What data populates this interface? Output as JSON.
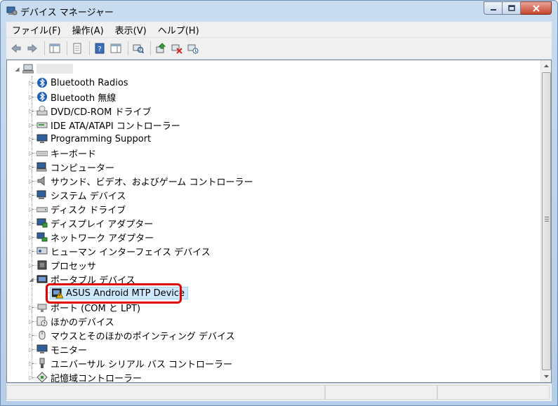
{
  "window": {
    "title": "デバイス マネージャー"
  },
  "menu": [
    "ファイル(F)",
    "操作(A)",
    "表示(V)",
    "ヘルプ(H)"
  ],
  "tree": {
    "computer_name_redacted": "",
    "items": [
      {
        "label": "Bluetooth Radios",
        "icon": "bluetooth-icon"
      },
      {
        "label": "Bluetooth 無線",
        "icon": "bluetooth-icon"
      },
      {
        "label": "DVD/CD-ROM ドライブ",
        "icon": "dvd-drive-icon"
      },
      {
        "label": "IDE ATA/ATAPI コントローラー",
        "icon": "ide-controller-icon"
      },
      {
        "label": "Programming Support",
        "icon": "monitor-icon"
      },
      {
        "label": "キーボード",
        "icon": "keyboard-icon"
      },
      {
        "label": "コンピューター",
        "icon": "computer-icon"
      },
      {
        "label": "サウンド、ビデオ、およびゲーム コントローラー",
        "icon": "speaker-icon"
      },
      {
        "label": "システム デバイス",
        "icon": "system-device-icon"
      },
      {
        "label": "ディスク ドライブ",
        "icon": "disk-drive-icon"
      },
      {
        "label": "ディスプレイ アダプター",
        "icon": "display-adapter-icon"
      },
      {
        "label": "ネットワーク アダプター",
        "icon": "network-adapter-icon"
      },
      {
        "label": "ヒューマン インターフェイス デバイス",
        "icon": "hid-icon"
      },
      {
        "label": "プロセッサ",
        "icon": "processor-icon"
      },
      {
        "label": "ポータブル デバイス",
        "icon": "portable-device-icon",
        "expanded": true
      },
      {
        "label": "ASUS Android MTP Device",
        "icon": "warning-device-icon",
        "child": true,
        "selected": true
      },
      {
        "label": "ポート (COM と LPT)",
        "icon": "port-icon"
      },
      {
        "label": "ほかのデバイス",
        "icon": "unknown-device-icon"
      },
      {
        "label": "マウスとそのほかのポインティング デバイス",
        "icon": "mouse-icon"
      },
      {
        "label": "モニター",
        "icon": "monitor-icon"
      },
      {
        "label": "ユニバーサル シリアル バス コントローラー",
        "icon": "usb-icon"
      },
      {
        "label": "記憶域コントローラー",
        "icon": "storage-controller-icon"
      }
    ]
  },
  "colors": {
    "highlight": "#e00000",
    "selection": "#cde8ff"
  }
}
